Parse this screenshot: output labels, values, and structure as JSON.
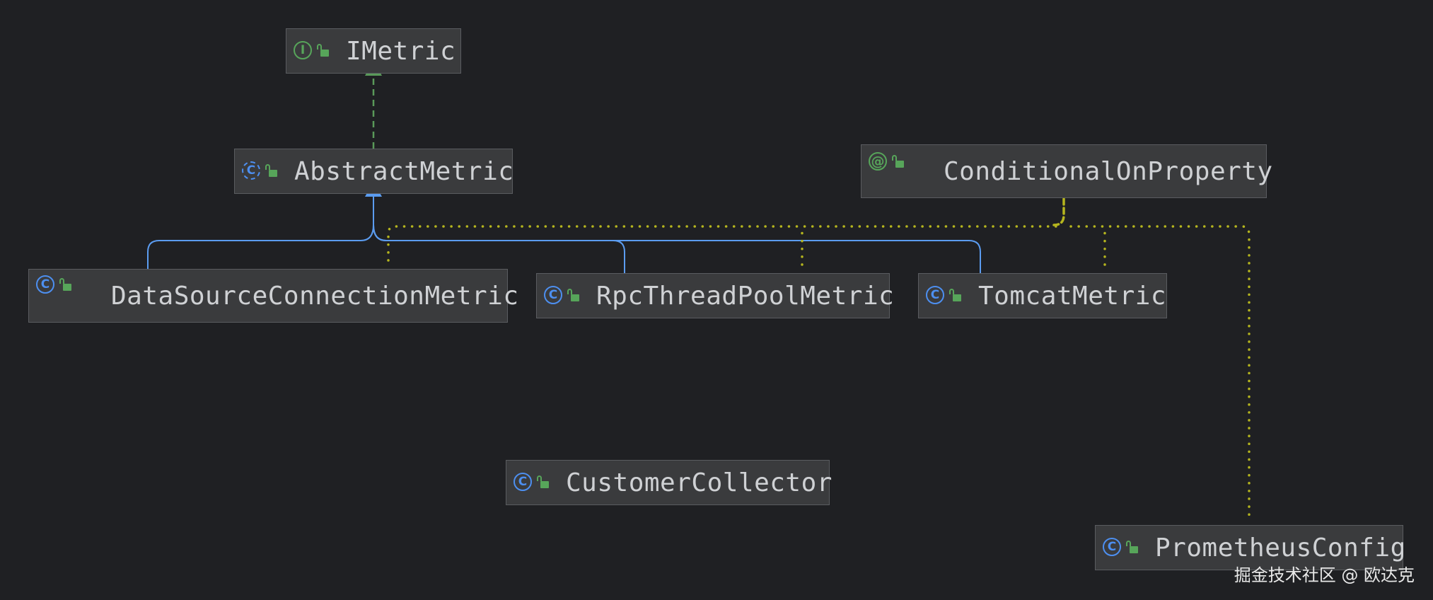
{
  "nodes": {
    "imetric": {
      "name": "IMetric",
      "kind": "interface",
      "kind_glyph": "I",
      "icon": "interface-icon"
    },
    "abstract_metric": {
      "name": "AbstractMetric",
      "kind": "abstract-class",
      "kind_glyph": "C",
      "icon": "abstract-class-icon"
    },
    "conditional_on_property": {
      "name": "ConditionalOnProperty",
      "kind": "annotation",
      "kind_glyph": "@",
      "icon": "annotation-icon"
    },
    "datasource_connection_metric": {
      "name": "DataSourceConnectionMetric",
      "kind": "class",
      "kind_glyph": "C",
      "icon": "class-icon"
    },
    "rpc_thread_pool_metric": {
      "name": "RpcThreadPoolMetric",
      "kind": "class",
      "kind_glyph": "C",
      "icon": "class-icon"
    },
    "tomcat_metric": {
      "name": "TomcatMetric",
      "kind": "class",
      "kind_glyph": "C",
      "icon": "class-icon"
    },
    "customer_collector": {
      "name": "CustomerCollector",
      "kind": "class",
      "kind_glyph": "C",
      "icon": "class-icon"
    },
    "prometheus_config": {
      "name": "PrometheusConfig",
      "kind": "class",
      "kind_glyph": "C",
      "icon": "class-icon"
    }
  },
  "edges": [
    {
      "from": "abstract_metric",
      "to": "imetric",
      "type": "implements"
    },
    {
      "from": "datasource_connection_metric",
      "to": "abstract_metric",
      "type": "extends"
    },
    {
      "from": "rpc_thread_pool_metric",
      "to": "abstract_metric",
      "type": "extends"
    },
    {
      "from": "tomcat_metric",
      "to": "abstract_metric",
      "type": "extends"
    },
    {
      "from": "datasource_connection_metric",
      "to": "conditional_on_property",
      "type": "annotated-with"
    },
    {
      "from": "rpc_thread_pool_metric",
      "to": "conditional_on_property",
      "type": "annotated-with"
    },
    {
      "from": "tomcat_metric",
      "to": "conditional_on_property",
      "type": "annotated-with"
    },
    {
      "from": "prometheus_config",
      "to": "conditional_on_property",
      "type": "annotated-with"
    }
  ],
  "colors": {
    "background": "#1f2023",
    "node_fill": "#3a3b3d",
    "node_border": "#5a5c60",
    "text": "#cfd1d4",
    "implements_edge": "#5a9a5a",
    "extends_edge": "#5b9cf0",
    "annotation_edge": "#b5b51e",
    "interface_icon": "#57a55a",
    "class_icon": "#4d8ff0",
    "visibility_icon": "#57a55a"
  },
  "visibility_icon": "lock-open-icon",
  "watermark": "掘金技术社区 @ 欧达克"
}
